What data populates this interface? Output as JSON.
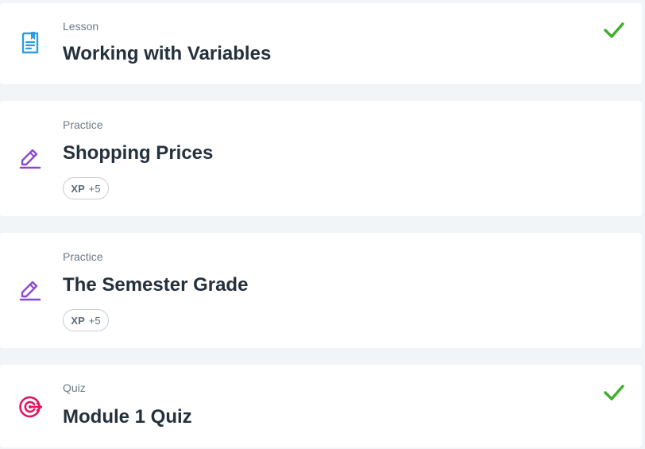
{
  "colors": {
    "background": "#f2f5f7",
    "card": "#ffffff",
    "lesson_icon": "#2d9ee0",
    "practice_icon": "#8a49d1",
    "quiz_icon": "#e0165f",
    "check": "#3fae2a",
    "title": "#24303c",
    "muted": "#6d7a86"
  },
  "items": [
    {
      "type": "Lesson",
      "icon": "lesson-document-icon",
      "title": "Working with Variables",
      "completed": true
    },
    {
      "type": "Practice",
      "icon": "pencil-icon",
      "title": "Shopping Prices",
      "xp_label": "XP",
      "xp_value": "+5",
      "completed": false
    },
    {
      "type": "Practice",
      "icon": "pencil-icon",
      "title": "The Semester Grade",
      "xp_label": "XP",
      "xp_value": "+5",
      "completed": false
    },
    {
      "type": "Quiz",
      "icon": "target-icon",
      "title": "Module 1 Quiz",
      "completed": true
    }
  ]
}
